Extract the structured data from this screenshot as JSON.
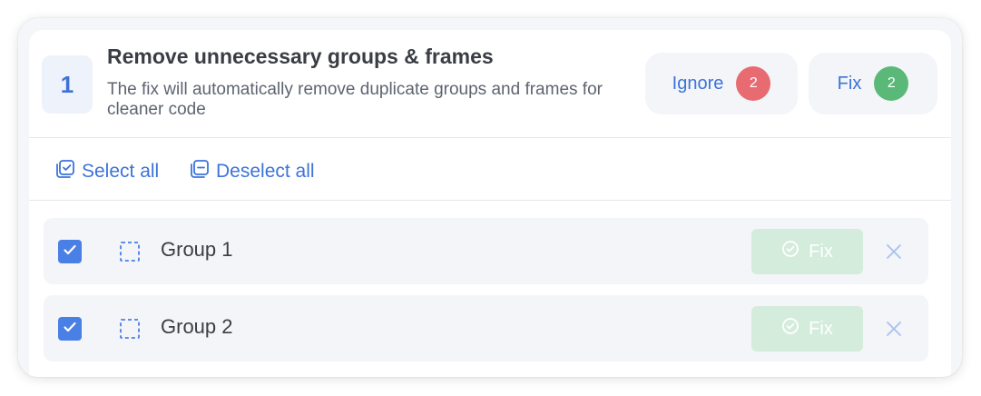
{
  "issue": {
    "number": "1",
    "title": "Remove unnecessary groups & frames",
    "description": "The fix will automatically remove duplicate groups and frames for cleaner code"
  },
  "actions": {
    "ignore_label": "Ignore",
    "ignore_count": "2",
    "fix_label": "Fix",
    "fix_count": "2"
  },
  "toolbar": {
    "select_all_label": "Select all",
    "deselect_all_label": "Deselect all"
  },
  "rows": [
    {
      "label": "Group 1",
      "checked": true,
      "fix_label": "Fix"
    },
    {
      "label": "Group 2",
      "checked": true,
      "fix_label": "Fix"
    }
  ],
  "colors": {
    "accent": "#3d73d9",
    "checkbox": "#4a7fe6",
    "ignore_count_bg": "#e86b72",
    "fix_count_bg": "#5ab978",
    "row_fix_bg": "#d4ecdc"
  },
  "icons": {
    "select_all": "select-all-icon",
    "deselect_all": "deselect-all-icon",
    "group": "dashed-group-icon",
    "check": "checkmark-icon",
    "fix": "check-circle-icon",
    "close": "close-icon"
  }
}
